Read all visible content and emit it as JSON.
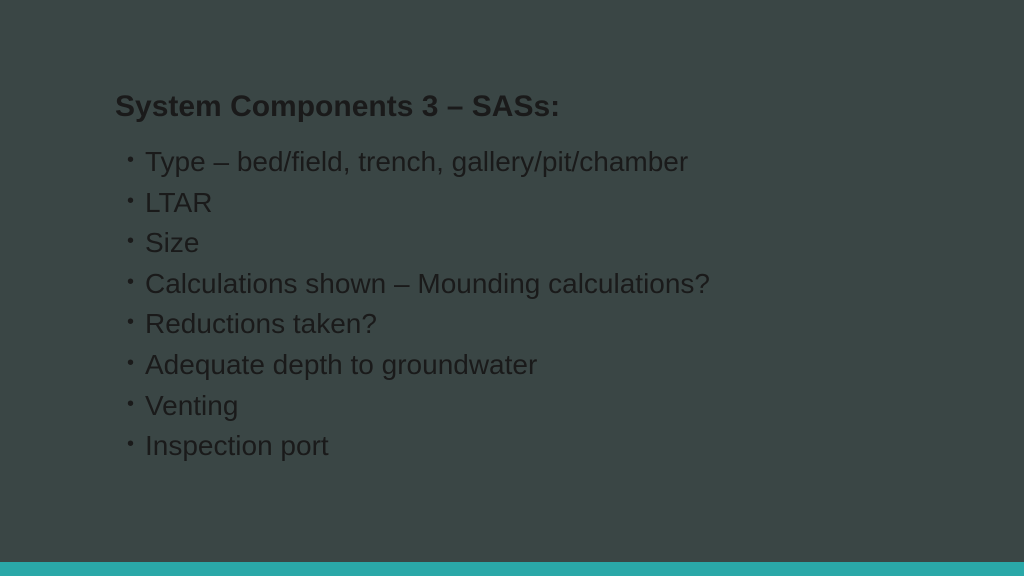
{
  "slide": {
    "title": "System Components 3 – SASs:",
    "bullets": [
      "Type – bed/field, trench, gallery/pit/chamber",
      "LTAR",
      "Size",
      "Calculations shown – Mounding calculations?",
      "Reductions taken?",
      "Adequate depth to groundwater",
      "Venting",
      "Inspection port"
    ]
  }
}
